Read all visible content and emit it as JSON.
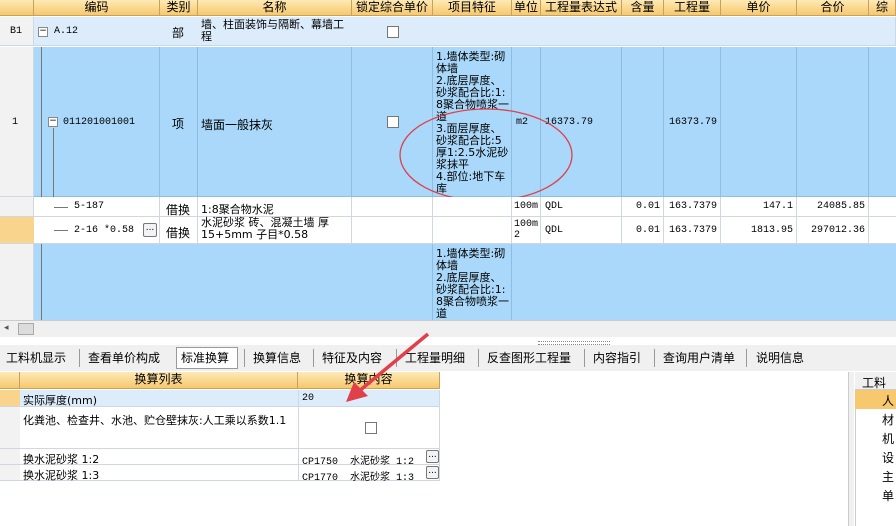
{
  "columns": [
    "编码",
    "类别",
    "名称",
    "锁定综合单价",
    "项目特征",
    "单位",
    "工程量表达式",
    "含量",
    "工程量",
    "单价",
    "合价",
    "综"
  ],
  "rows": {
    "b1": {
      "index": "B1",
      "code": "A.12",
      "type": "部",
      "name": "墙、柱面装饰与隔断、幕墙工程"
    },
    "r1": {
      "index": "1",
      "code": "011201001001",
      "type": "项",
      "name": "墙面一般抹灰",
      "features": "1.墙体类型:砌体墙\n2.底层厚度、砂浆配合比:1:8聚合物喷浆一道\n3.面层厚度、砂浆配合比:5厚1:2.5水泥砂浆抹平\n4.部位:地下车库",
      "unit": "m2",
      "expr": "16373.79",
      "qty": "16373.79"
    },
    "s1": {
      "code": "5-187",
      "type": "借换",
      "name": "1:8聚合物水泥",
      "unit": "100m",
      "expr": "QDL",
      "content": "0.01",
      "qty": "163.7379",
      "price": "147.1",
      "total": "24085.85"
    },
    "s2": {
      "code": "2-16 *0.58",
      "type": "借换",
      "name": "水泥砂浆 砖、混凝土墙 厚15+5mm 子目*0.58",
      "unit": "100m\n2",
      "expr": "QDL",
      "content": "0.01",
      "qty": "163.7379",
      "price": "1813.95",
      "total": "297012.36"
    },
    "r2": {
      "features": "1.墙体类型:砌体墙\n2.底层厚度、砂浆配合比:1:8聚合物喷浆一道"
    }
  },
  "tabs": [
    "工料机显示",
    "查看单价构成",
    "标准换算",
    "换算信息",
    "特征及内容",
    "工程量明细",
    "反查图形工程量",
    "内容指引",
    "查询用户清单",
    "说明信息"
  ],
  "active_tab": "标准换算",
  "sub_headers": {
    "list": "换算列表",
    "content": "换算内容"
  },
  "sub_rows": [
    {
      "label": "实际厚度(mm)",
      "value": "20"
    },
    {
      "label": "化粪池、检查井、水池、贮仓壁抹灰:人工乘以系数1.1",
      "value": ""
    },
    {
      "label": "换水泥砂浆 1:2",
      "value": "CP1750  水泥砂浆 1:2"
    },
    {
      "label": "换水泥砂浆 1:3",
      "value": "CP1770  水泥砂浆 1:3"
    }
  ],
  "right_panel": {
    "header": "工料机",
    "items": [
      "人",
      "材",
      "机",
      "设",
      "主",
      "单"
    ]
  },
  "colors": {
    "row_blue": "#a9d8fa",
    "header_orange": "#f7c86e",
    "annotation_red": "#e0404a"
  }
}
